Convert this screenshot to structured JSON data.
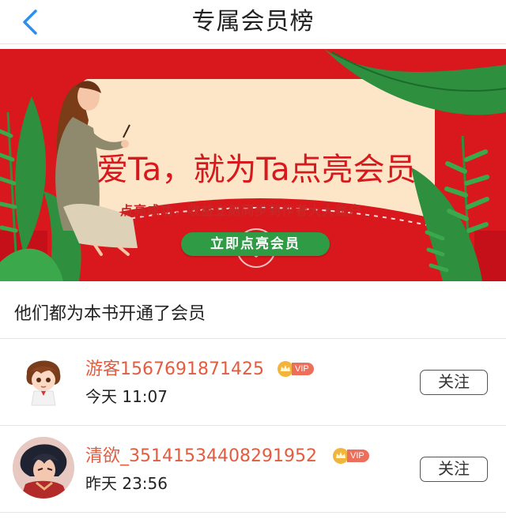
{
  "header": {
    "title": "专属会员榜",
    "back_icon": "chevron-left-icon"
  },
  "banner": {
    "headline": "爱Ta，就为Ta点亮会员",
    "subline": "点亮成功，收益立刻同步到作者大大账户",
    "cta_label": "立即点亮会员",
    "colors": {
      "background": "#d8181c",
      "card": "#fde6c8",
      "cta": "#2f9b45"
    }
  },
  "section": {
    "title": "他们都为本书开通了会员"
  },
  "members": [
    {
      "name": "游客1567691871425",
      "badge": "VIP",
      "time": "今天 11:07",
      "follow_label": "关注"
    },
    {
      "name": "清欲_35141534408291952",
      "badge": "VIP",
      "time": "昨天 23:56",
      "follow_label": "关注"
    }
  ],
  "colors": {
    "accent_name": "#e45c3f",
    "vip_badge": "#ec6f5b",
    "crown": "#f3b43c"
  }
}
